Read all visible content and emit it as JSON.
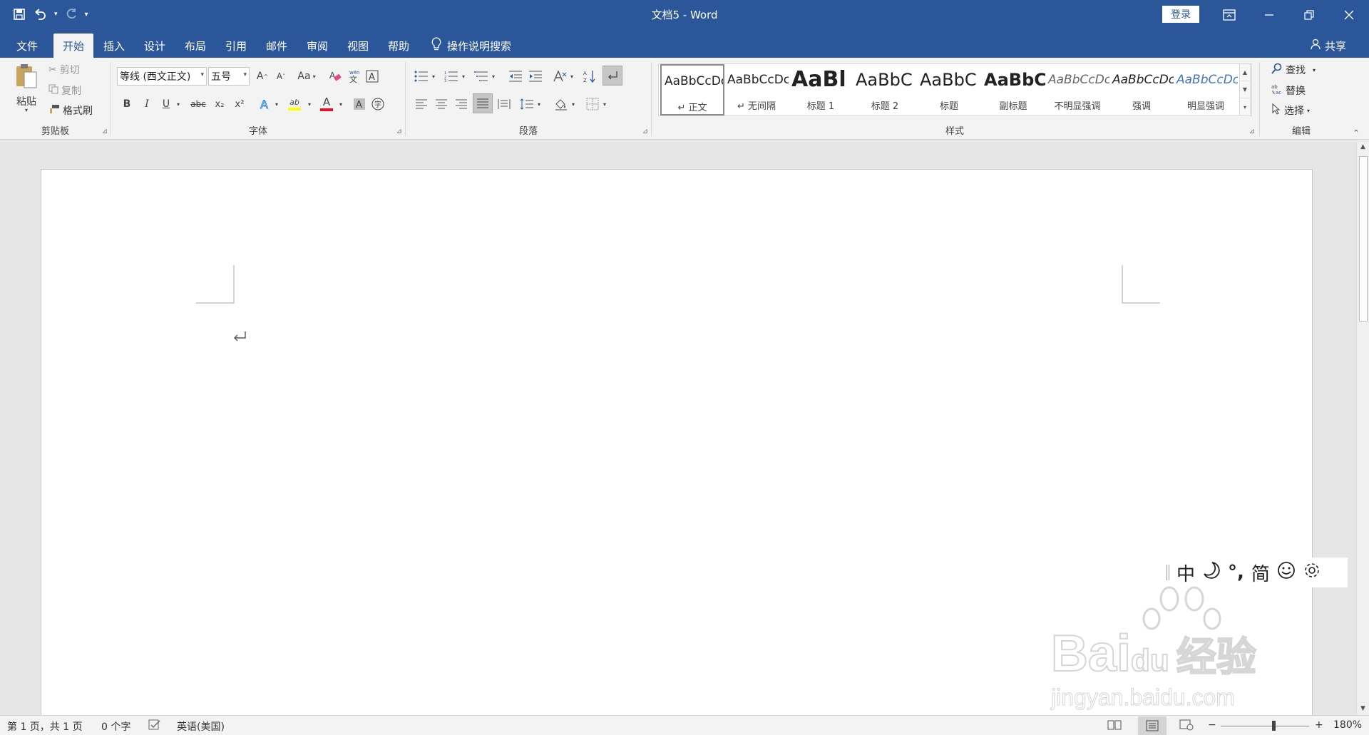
{
  "window": {
    "title": "文档5 - Word",
    "login": "登录"
  },
  "tabs": [
    "文件",
    "开始",
    "插入",
    "设计",
    "布局",
    "引用",
    "邮件",
    "审阅",
    "视图",
    "帮助"
  ],
  "active_tab": "开始",
  "tell_me": "操作说明搜索",
  "share": "共享",
  "clipboard": {
    "paste": "粘贴",
    "cut": "剪切",
    "copy": "复制",
    "format_painter": "格式刷",
    "label": "剪贴板"
  },
  "font": {
    "name": "等线 (西文正文)",
    "size": "五号",
    "label": "字体",
    "grow": "A",
    "shrink": "A",
    "case": "Aa",
    "bold": "B",
    "italic": "I",
    "underline": "U",
    "strike": "abc",
    "subscript": "x₂",
    "superscript": "x²",
    "font_color_letter": "A",
    "highlight_letter": "ab"
  },
  "paragraph": {
    "label": "段落"
  },
  "styles": {
    "label": "样式",
    "items": [
      {
        "preview": "AaBbCcDc",
        "name": "↵ 正文"
      },
      {
        "preview": "AaBbCcDc",
        "name": "↵ 无间隔"
      },
      {
        "preview": "AaBl",
        "name": "标题 1"
      },
      {
        "preview": "AaBbC",
        "name": "标题 2"
      },
      {
        "preview": "AaBbC",
        "name": "标题"
      },
      {
        "preview": "AaBbC",
        "name": "副标题"
      },
      {
        "preview": "AaBbCcDc",
        "name": "不明显强调"
      },
      {
        "preview": "AaBbCcDc",
        "name": "强调"
      },
      {
        "preview": "AaBbCcDc",
        "name": "明显强调"
      }
    ]
  },
  "editing": {
    "label": "编辑",
    "find": "查找",
    "replace": "替换",
    "select": "选择"
  },
  "ime": {
    "mode": "中",
    "punct": "°,",
    "script": "简"
  },
  "watermark": {
    "brand": "Bai",
    "brand2": "du",
    "cn": "经验",
    "url": "jingyan.baidu.com"
  },
  "status": {
    "page": "第 1 页，共 1 页",
    "words": "0 个字",
    "language": "英语(美国)",
    "zoom_out": "−",
    "zoom_in": "+",
    "zoom": "180%",
    "zoom_level": 1.8
  },
  "colors": {
    "brand": "#2b579a",
    "ribbon": "#f3f3f3",
    "font_color": "#e81123",
    "highlight": "#ffff00"
  }
}
